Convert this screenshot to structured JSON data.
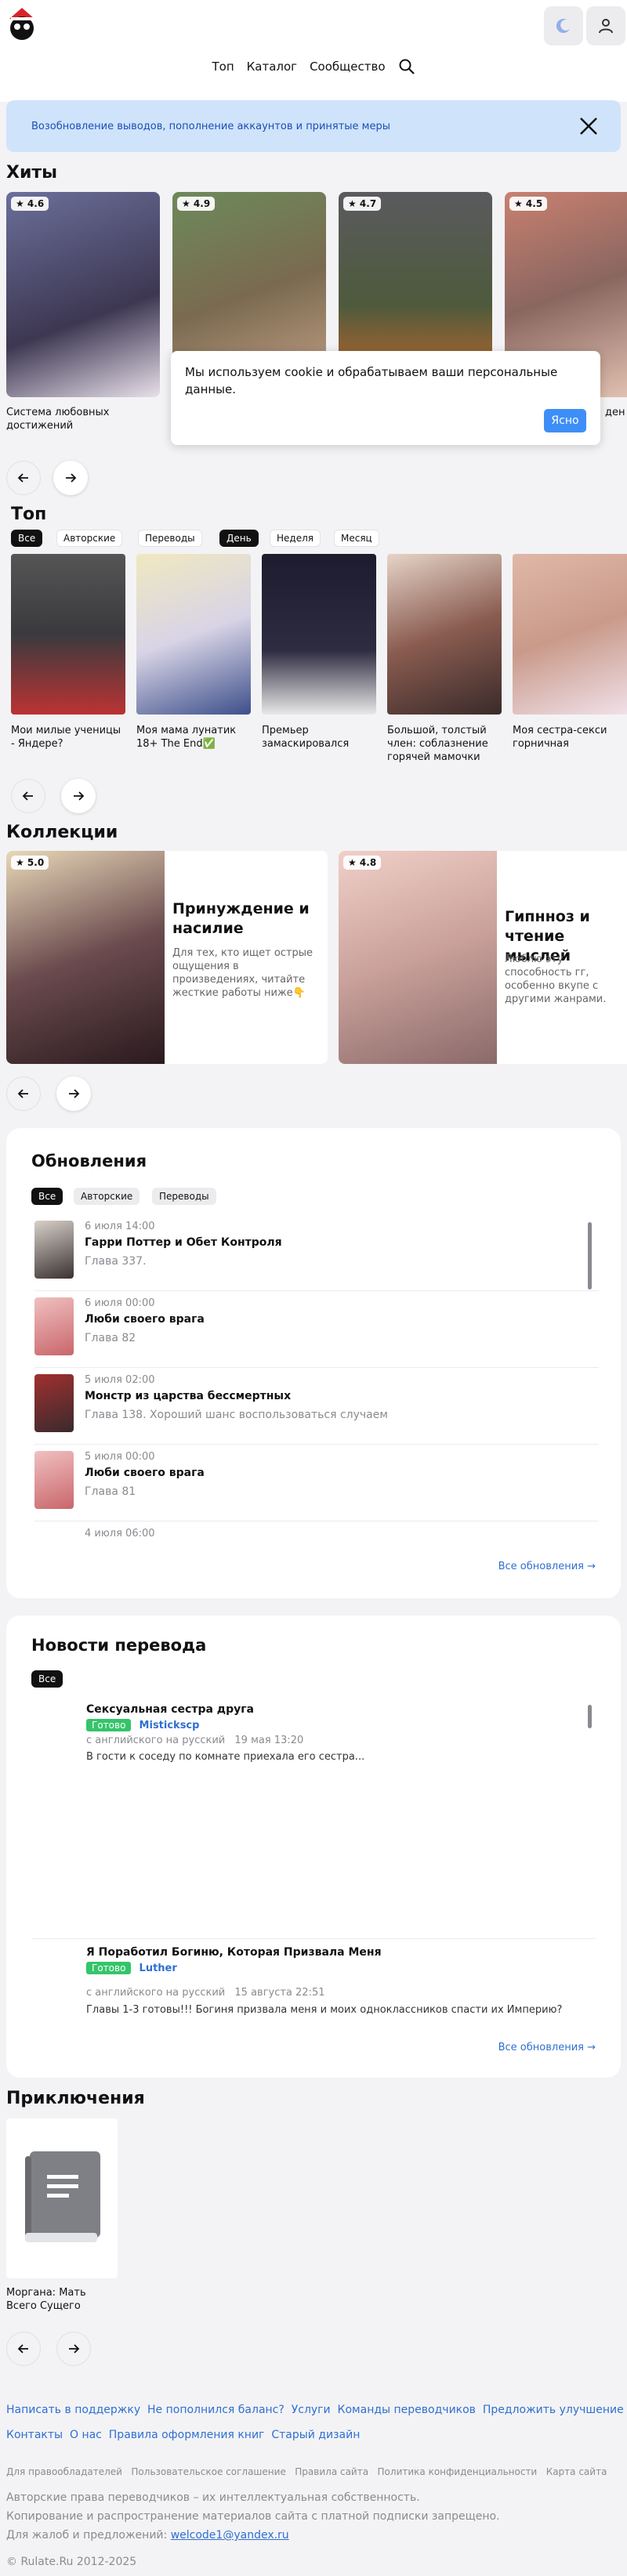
{
  "header": {
    "nav": [
      "Топ",
      "Каталог",
      "Сообщество"
    ],
    "search_icon": "search-icon",
    "theme_icon": "moon-icon",
    "user_icon": "user-icon"
  },
  "banner": {
    "text": "Возобновление выводов, пополнение аккаунтов и принятые меры"
  },
  "hits": {
    "title": "Хиты",
    "cards": [
      {
        "rating": "★ 4.6",
        "title": "Система любовных достижений",
        "color": "#3d3752"
      },
      {
        "rating": "★ 4.9",
        "title": "",
        "color": "#7a6a50"
      },
      {
        "rating": "★ 4.7",
        "title": "",
        "color": "#4e5a3c"
      },
      {
        "rating": "★ 4.5",
        "title": "ден",
        "color": "#8a6660"
      }
    ]
  },
  "cookie": {
    "text": "Мы используем cookie и обрабатываем ваши персональные данные.",
    "button": "Ясно"
  },
  "top": {
    "title": "Топ",
    "filters": [
      "Все",
      "Авторские",
      "Переводы"
    ],
    "periods": [
      "День",
      "Неделя",
      "Месяц"
    ],
    "cards": [
      {
        "title": "Мои милые ученицы - Яндере?",
        "color": "#3a3a3e"
      },
      {
        "title": "Моя мама лунатик 18+ The End✅",
        "color": "#d8d4e6"
      },
      {
        "title": "Премьер замаскировался",
        "color": "#2e2c40"
      },
      {
        "title": "Большой, толстый член: соблазнение горячей мамочки",
        "color": "#8a5c50"
      },
      {
        "title": "Моя сестра-секси горничная",
        "color": "#c99a8a"
      }
    ]
  },
  "collections": {
    "title": "Коллекции",
    "cards": [
      {
        "rating": "★ 5.0",
        "title": "Принуждение и насилие",
        "desc": "Для тех, кто ищет острые ощущения в произведениях, читайте жесткие работы ниже👇",
        "color": "#6b4b4e"
      },
      {
        "rating": "★ 4.8",
        "title": "Гипнноз и чтение мыслей",
        "desc": "Люблю эту способность гг, особенно вкупе с другими жанрами.",
        "color": "#c9a09a"
      }
    ]
  },
  "updates": {
    "title": "Обновления",
    "filters": [
      "Все",
      "Авторские",
      "Переводы"
    ],
    "items": [
      {
        "date": "6 июля  14:00",
        "title": "Гарри Поттер и Обет Контроля",
        "chapter": "Глава 337.",
        "color": "#3a3232"
      },
      {
        "date": "6 июля  00:00",
        "title": "Люби своего врага",
        "chapter": "Глава 82",
        "color": "#c9666b"
      },
      {
        "date": "5 июля  02:00",
        "title": "Монстр из царства бессмертных",
        "chapter": "Глава 138. Хороший шанс воспользоваться случаем",
        "color": "#3a2a2e"
      },
      {
        "date": "5 июля  00:00",
        "title": "Люби своего врага",
        "chapter": "Глава 81",
        "color": "#c9666b"
      },
      {
        "date": "4 июля  06:00",
        "title": "",
        "chapter": "",
        "color": "#cccccc"
      }
    ],
    "all_link": "Все обновления →"
  },
  "news": {
    "title": "Новости перевода",
    "filter": "Все",
    "items": [
      {
        "title": "Сексуальная сестра друга",
        "status": "Готово",
        "team": "Mistickscp",
        "lang": "с английского на русский",
        "date": "19 мая  13:20",
        "text": "В гости к соседу по комнате приехала его сестра..."
      },
      {
        "title": "Я Поработил Богиню, Которая Призвала Меня",
        "status": "Готово",
        "team": "Luther",
        "lang": "с английского на русский",
        "date": "15 августа  22:51",
        "text": "Главы 1-3 готовы!!! Богиня призвала меня и моих одноклассников спасти их Империю?"
      }
    ],
    "all_link": "Все обновления →"
  },
  "adventures": {
    "title": "Приключения",
    "cards": [
      {
        "title": "Моргана: Мать Всего Сущего",
        "icon": "book-icon"
      }
    ]
  },
  "footer": {
    "links1": [
      "Написать в поддержку",
      "Не пополнился баланс?",
      "Услуги",
      "Команды переводчиков",
      "Предложить улучшение"
    ],
    "links2": [
      "Контакты",
      "О нас",
      "Правила оформления книг",
      "Старый дизайн"
    ],
    "small_links": [
      "Для правообладателей",
      "Пользовательское соглашение",
      "Правила сайта",
      "Политика конфиденциальности",
      "Карта сайта"
    ],
    "rights": "Авторские права переводчиков – их интеллектуальная собственность.",
    "copy_rule": "Копирование и распространение материалов сайта с платной подписки запрещено.",
    "complaints_label": "Для жалоб и предложений:",
    "email": "welcode1@yandex.ru",
    "copyright": "© Rulate.Ru 2012-2025"
  }
}
